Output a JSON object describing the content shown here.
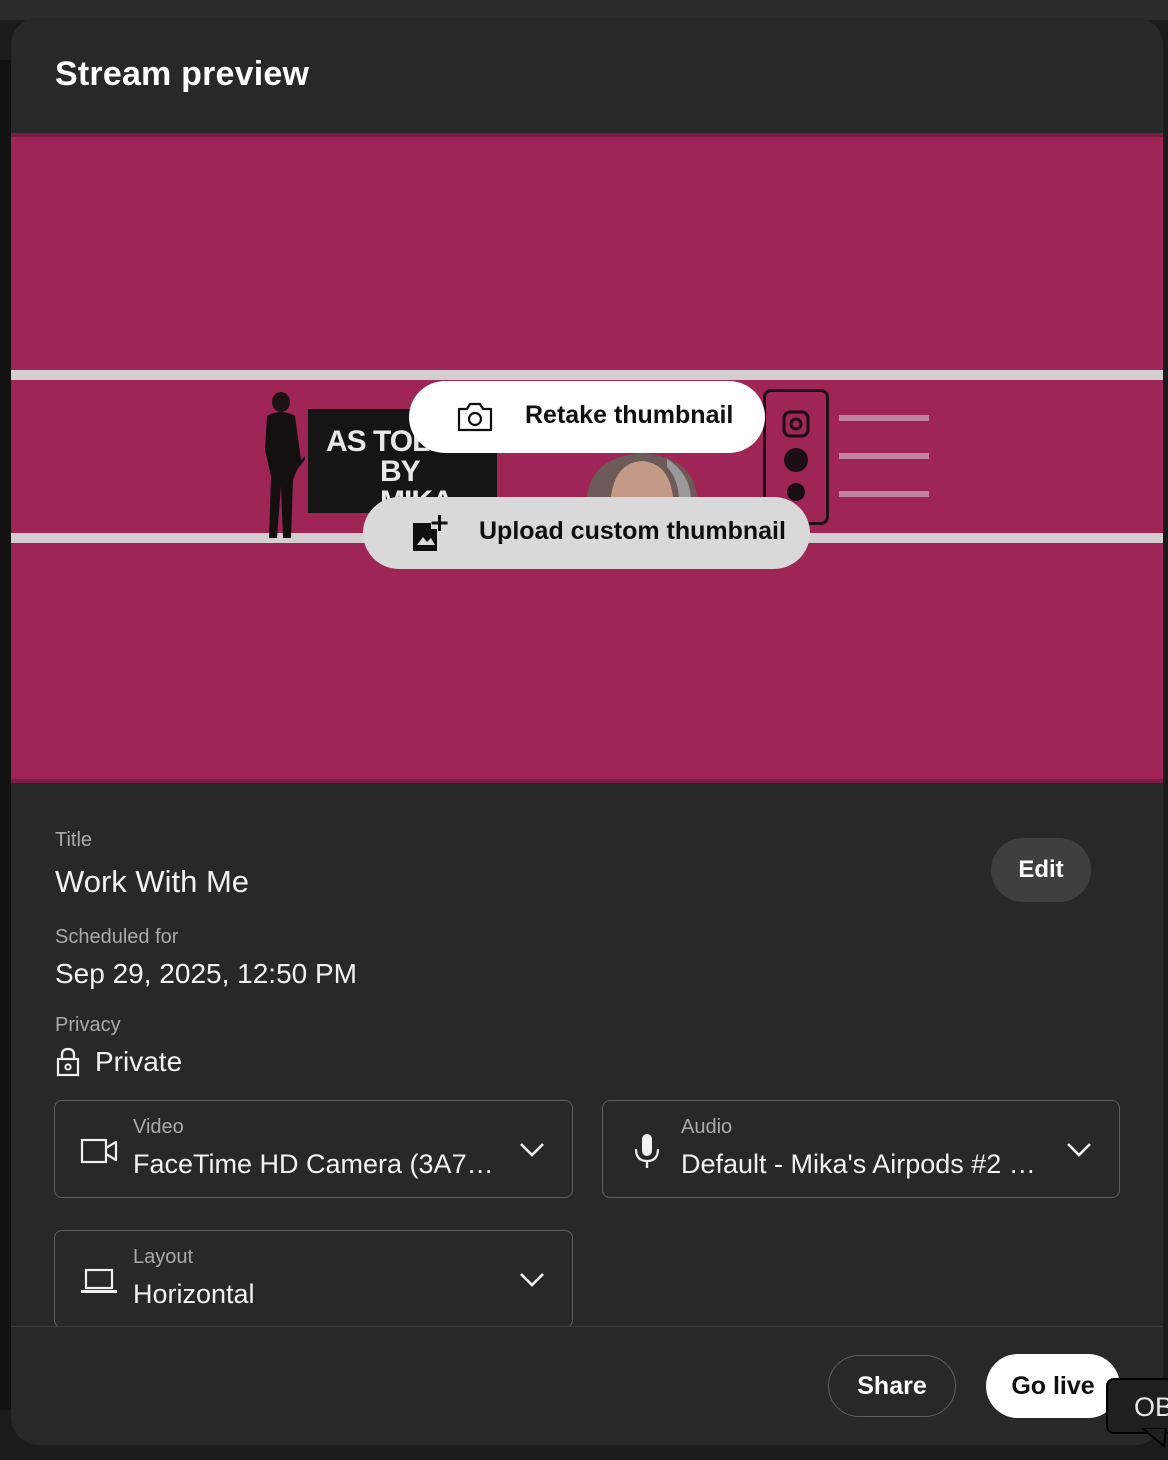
{
  "dialog": {
    "title": "Stream preview"
  },
  "preview": {
    "banner_logo_line1": "AS TOLD",
    "banner_logo_line2": "BY MIKA",
    "retake_label": "Retake thumbnail",
    "upload_label": "Upload custom thumbnail"
  },
  "details": {
    "title_label": "Title",
    "title_value": "Work With Me",
    "edit_label": "Edit",
    "scheduled_label": "Scheduled for",
    "scheduled_value": "Sep 29, 2025, 12:50 PM",
    "privacy_label": "Privacy",
    "privacy_value": "Private"
  },
  "selects": {
    "video": {
      "label": "Video",
      "value": "FaceTime HD Camera (3A7…"
    },
    "audio": {
      "label": "Audio",
      "value": "Default - Mika's Airpods #2 …"
    },
    "layout": {
      "label": "Layout",
      "value": "Horizontal"
    }
  },
  "footer": {
    "share_label": "Share",
    "golive_label": "Go live"
  },
  "tooltip": {
    "text": "OB"
  },
  "colors": {
    "dialog_bg": "#282828",
    "preview_bg": "#9e2556",
    "primary_button_bg": "#ffffff"
  },
  "icons": [
    "camera-icon",
    "add-photo-icon",
    "lock-icon",
    "video-camera-icon",
    "microphone-icon",
    "laptop-icon",
    "chevron-down-icon"
  ]
}
